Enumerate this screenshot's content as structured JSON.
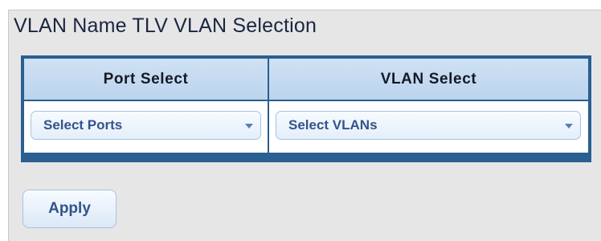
{
  "section": {
    "title": "VLAN Name TLV VLAN Selection"
  },
  "table": {
    "columns": [
      "Port Select",
      "VLAN Select"
    ],
    "port_select": {
      "value": "Select Ports"
    },
    "vlan_select": {
      "value": "Select VLANs"
    }
  },
  "actions": {
    "apply_label": "Apply"
  },
  "colors": {
    "table_border": "#2a5f91",
    "header_bg": "#c6dbf1",
    "control_text": "#33548a",
    "panel_bg": "#e6e6e6"
  },
  "icons": {
    "dropdown": "chevron-down-icon"
  }
}
